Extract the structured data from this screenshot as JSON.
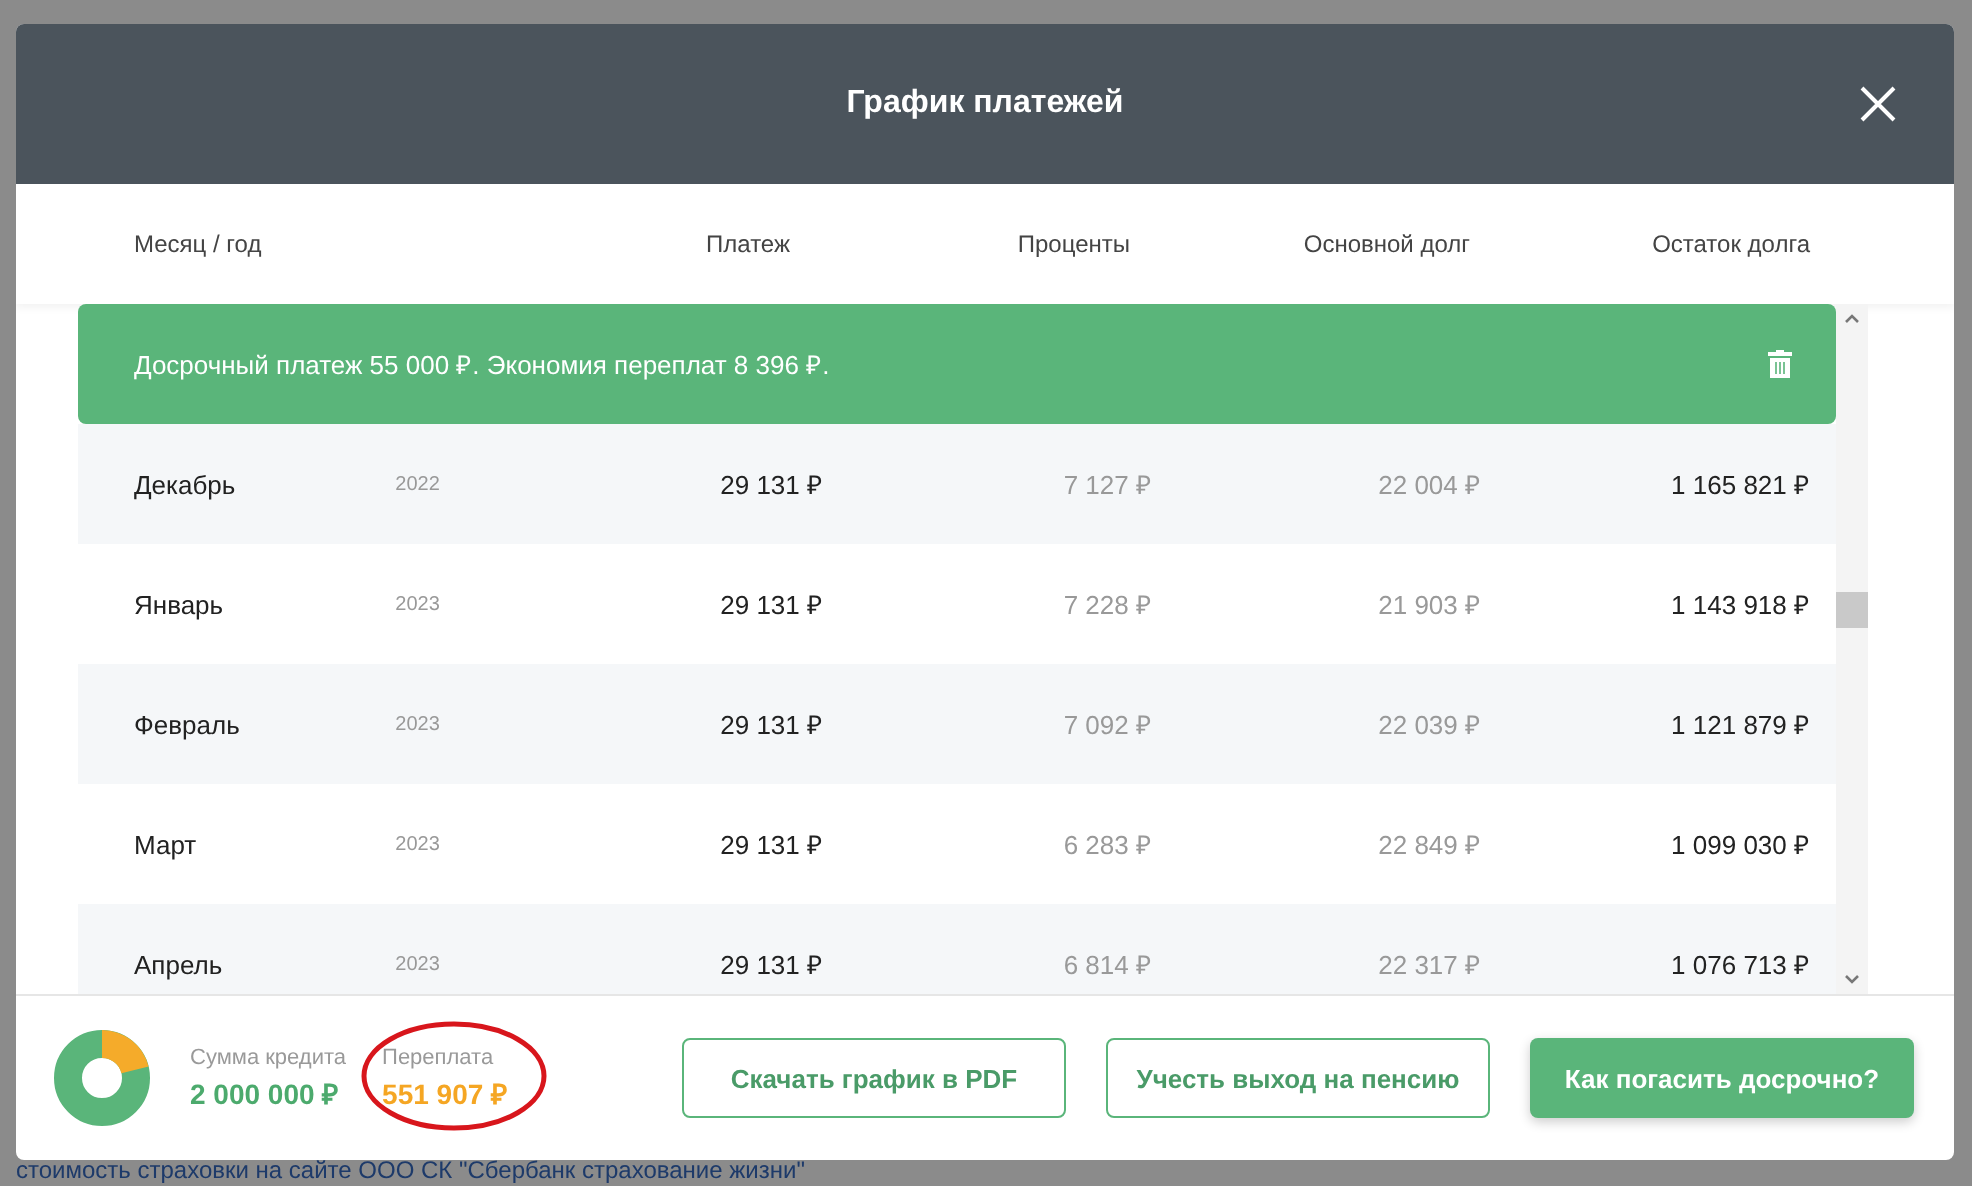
{
  "modal": {
    "title": "График платежей"
  },
  "table": {
    "columns": [
      "Месяц / год",
      "Платеж",
      "Проценты",
      "Основной долг",
      "Остаток долга"
    ],
    "rows": [
      {
        "kind": "early",
        "text": "Досрочный платеж 55 000 ₽. Экономия переплат 8 396 ₽."
      },
      {
        "kind": "month",
        "month": "Декабрь",
        "year": "2022",
        "payment": "29 131 ₽",
        "interest": "7 127 ₽",
        "principal": "22 004 ₽",
        "balance": "1 165 821 ₽"
      },
      {
        "kind": "month",
        "month": "Январь",
        "year": "2023",
        "payment": "29 131 ₽",
        "interest": "7 228 ₽",
        "principal": "21 903 ₽",
        "balance": "1 143 918 ₽"
      },
      {
        "kind": "month",
        "month": "Февраль",
        "year": "2023",
        "payment": "29 131 ₽",
        "interest": "7 092 ₽",
        "principal": "22 039 ₽",
        "balance": "1 121 879 ₽"
      },
      {
        "kind": "month",
        "month": "Март",
        "year": "2023",
        "payment": "29 131 ₽",
        "interest": "6 283 ₽",
        "principal": "22 849 ₽",
        "balance": "1 099 030 ₽"
      },
      {
        "kind": "month",
        "month": "Апрель",
        "year": "2023",
        "payment": "29 131 ₽",
        "interest": "6 814 ₽",
        "principal": "22 317 ₽",
        "balance": "1 076 713 ₽"
      }
    ]
  },
  "summary": {
    "loan_label": "Сумма кредита",
    "loan_value": "2 000 000 ₽",
    "overpay_label": "Переплата",
    "overpay_value": "551 907 ₽"
  },
  "buttons": [
    {
      "kind": "outline",
      "label": "Скачать график в PDF"
    },
    {
      "kind": "outline",
      "label": "Учесть выход на пенсию"
    },
    {
      "kind": "primary",
      "label": "Как погасить досрочно?"
    }
  ],
  "background_text": "стоимость страховки на сайте ООО СК \"Сбербанк страхование жизни\""
}
